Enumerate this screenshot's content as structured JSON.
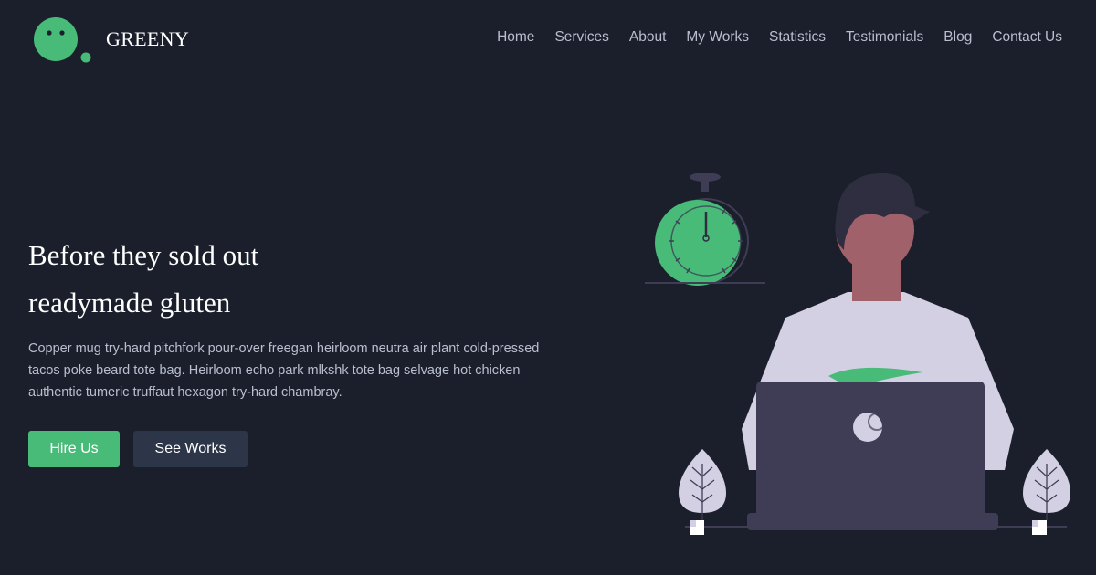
{
  "header": {
    "brand": "GREENY",
    "nav": [
      "Home",
      "Services",
      "About",
      "My Works",
      "Statistics",
      "Testimonials",
      "Blog",
      "Contact Us"
    ]
  },
  "hero": {
    "title_line1": "Before they sold out",
    "title_line2": "readymade gluten",
    "description": "Copper mug try-hard pitchfork pour-over freegan heirloom neutra air plant cold-pressed tacos poke beard tote bag. Heirloom echo park mlkshk tote bag selvage hot chicken authentic tumeric truffaut hexagon try-hard chambray.",
    "primary_button": "Hire Us",
    "secondary_button": "See Works"
  },
  "colors": {
    "background": "#1b1f2b",
    "accent": "#48bb78",
    "nav_text": "#b9bfcf",
    "secondary_button": "#2d3548"
  },
  "icons": [
    "logo-mark-icon",
    "stopwatch-icon",
    "laptop-icon",
    "plant-icon"
  ]
}
